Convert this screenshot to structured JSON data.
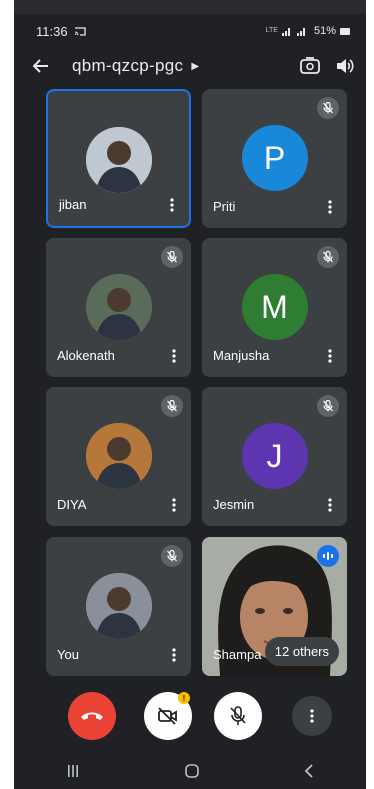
{
  "status_bar": {
    "time": "11:36",
    "network_label": "LTE",
    "battery": "51%"
  },
  "header": {
    "meeting_code": "qbm-qzcp-pgc"
  },
  "participants": [
    {
      "name": "jiban",
      "initial": "",
      "avatar_color": "#bfc7cf",
      "muted": false,
      "active": true
    },
    {
      "name": "Priti",
      "initial": "P",
      "avatar_color": "#1a88d8",
      "muted": true,
      "active": false
    },
    {
      "name": "Alokenath",
      "initial": "",
      "avatar_color": "#5a6b5a",
      "muted": true,
      "active": false
    },
    {
      "name": "Manjusha",
      "initial": "M",
      "avatar_color": "#2e7d32",
      "muted": true,
      "active": false
    },
    {
      "name": "DIYA",
      "initial": "",
      "avatar_color": "#b5783a",
      "muted": true,
      "active": false
    },
    {
      "name": "Jesmin",
      "initial": "J",
      "avatar_color": "#5e35b1",
      "muted": true,
      "active": false
    },
    {
      "name": "You",
      "initial": "",
      "avatar_color": "#8a9099",
      "muted": true,
      "active": false
    }
  ],
  "video_tile": {
    "name": "Shampa",
    "others_label": "12 others"
  },
  "controls": {
    "camera_badge": "!"
  },
  "colors": {
    "end_call": "#ea4335",
    "accent_blue": "#1a73e8",
    "tile_bg": "#3c4043",
    "app_bg": "#202124"
  }
}
